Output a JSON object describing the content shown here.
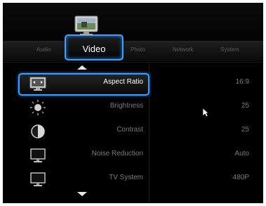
{
  "tabs": [
    {
      "label": "Audio"
    },
    {
      "label": "Video"
    },
    {
      "label": "Photo"
    },
    {
      "label": "Network"
    },
    {
      "label": "System"
    }
  ],
  "settings": [
    {
      "label": "Aspect Ratio",
      "value": "16:9",
      "icon": "aspect-ratio-icon"
    },
    {
      "label": "Brightness",
      "value": "25",
      "icon": "brightness-icon"
    },
    {
      "label": "Contrast",
      "value": "25",
      "icon": "contrast-icon"
    },
    {
      "label": "Noise Reduction",
      "value": "Auto",
      "icon": "monitor-icon"
    },
    {
      "label": "TV System",
      "value": "480P",
      "icon": "tv-icon"
    }
  ],
  "colors": {
    "accent": "#3aa0ff",
    "background": "#000000",
    "inactive_text": "#7a7a7a"
  }
}
